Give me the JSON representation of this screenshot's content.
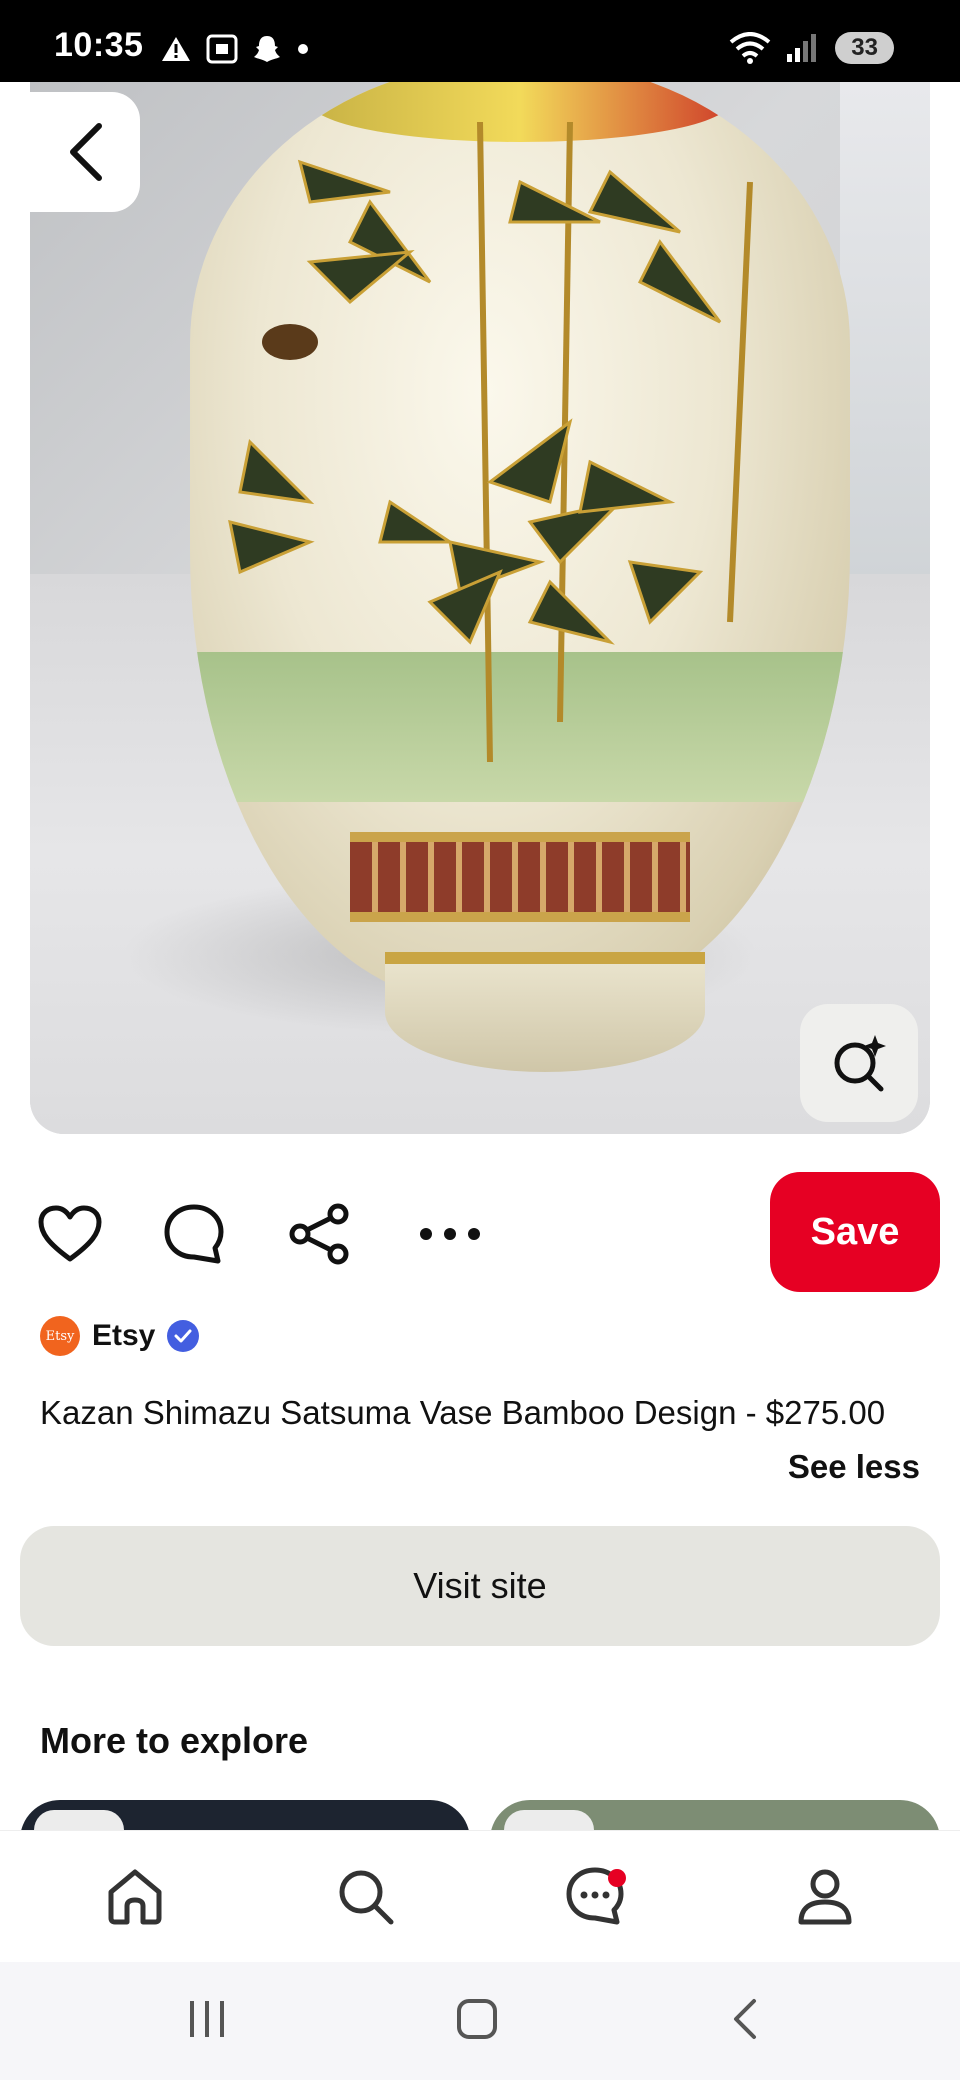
{
  "status_bar": {
    "time": "10:35",
    "battery": "33",
    "icons": [
      "alert-icon",
      "screenshot-icon",
      "snapchat-icon",
      "dot-icon",
      "wifi-icon",
      "signal-icon"
    ]
  },
  "pin": {
    "image_alt": "Kazan Shimazu Satsuma vase with bamboo design",
    "source": "Etsy",
    "source_avatar_text": "Etsy",
    "verified": true,
    "title": "Kazan Shimazu Satsuma Vase Bamboo Design - $275.00",
    "see_less": "See less"
  },
  "actions": {
    "save": "Save",
    "visit_site": "Visit site"
  },
  "more": {
    "heading": "More to explore"
  },
  "bottom_nav": [
    "home",
    "search",
    "messages",
    "profile"
  ],
  "colors": {
    "accent": "#e60023",
    "visit_bg": "#e5e5e0",
    "verified": "#435ee0",
    "etsy": "#f1641e"
  }
}
